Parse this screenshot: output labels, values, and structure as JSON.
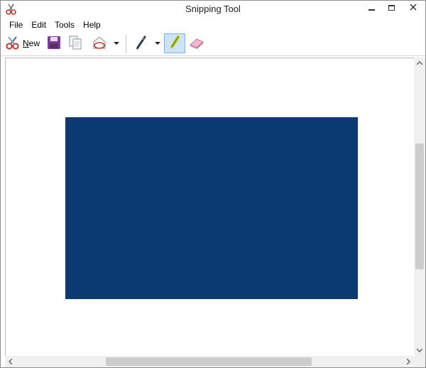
{
  "window": {
    "title": "Snipping Tool",
    "icon": "scissors-icon"
  },
  "menu": {
    "items": [
      {
        "label": "File"
      },
      {
        "label": "Edit"
      },
      {
        "label": "Tools"
      },
      {
        "label": "Help"
      }
    ]
  },
  "toolbar": {
    "new_label": "New",
    "new_icon": "scissors-icon",
    "save_icon": "floppy-disk-icon",
    "copy_icon": "copy-icon",
    "send_icon": "send-snip-icon",
    "pen_icon": "pen-icon",
    "highlighter_icon": "highlighter-icon",
    "eraser_icon": "eraser-icon",
    "highlighter_active": true
  },
  "capture": {
    "fill_color": "#0b3a72",
    "background_color": "#ffffff"
  },
  "colors": {
    "accent_selected": "#cce4f7",
    "accent_border": "#7eb4ea",
    "scrollbar_track": "#f0f0f0",
    "scrollbar_thumb": "#cdcdcd"
  }
}
